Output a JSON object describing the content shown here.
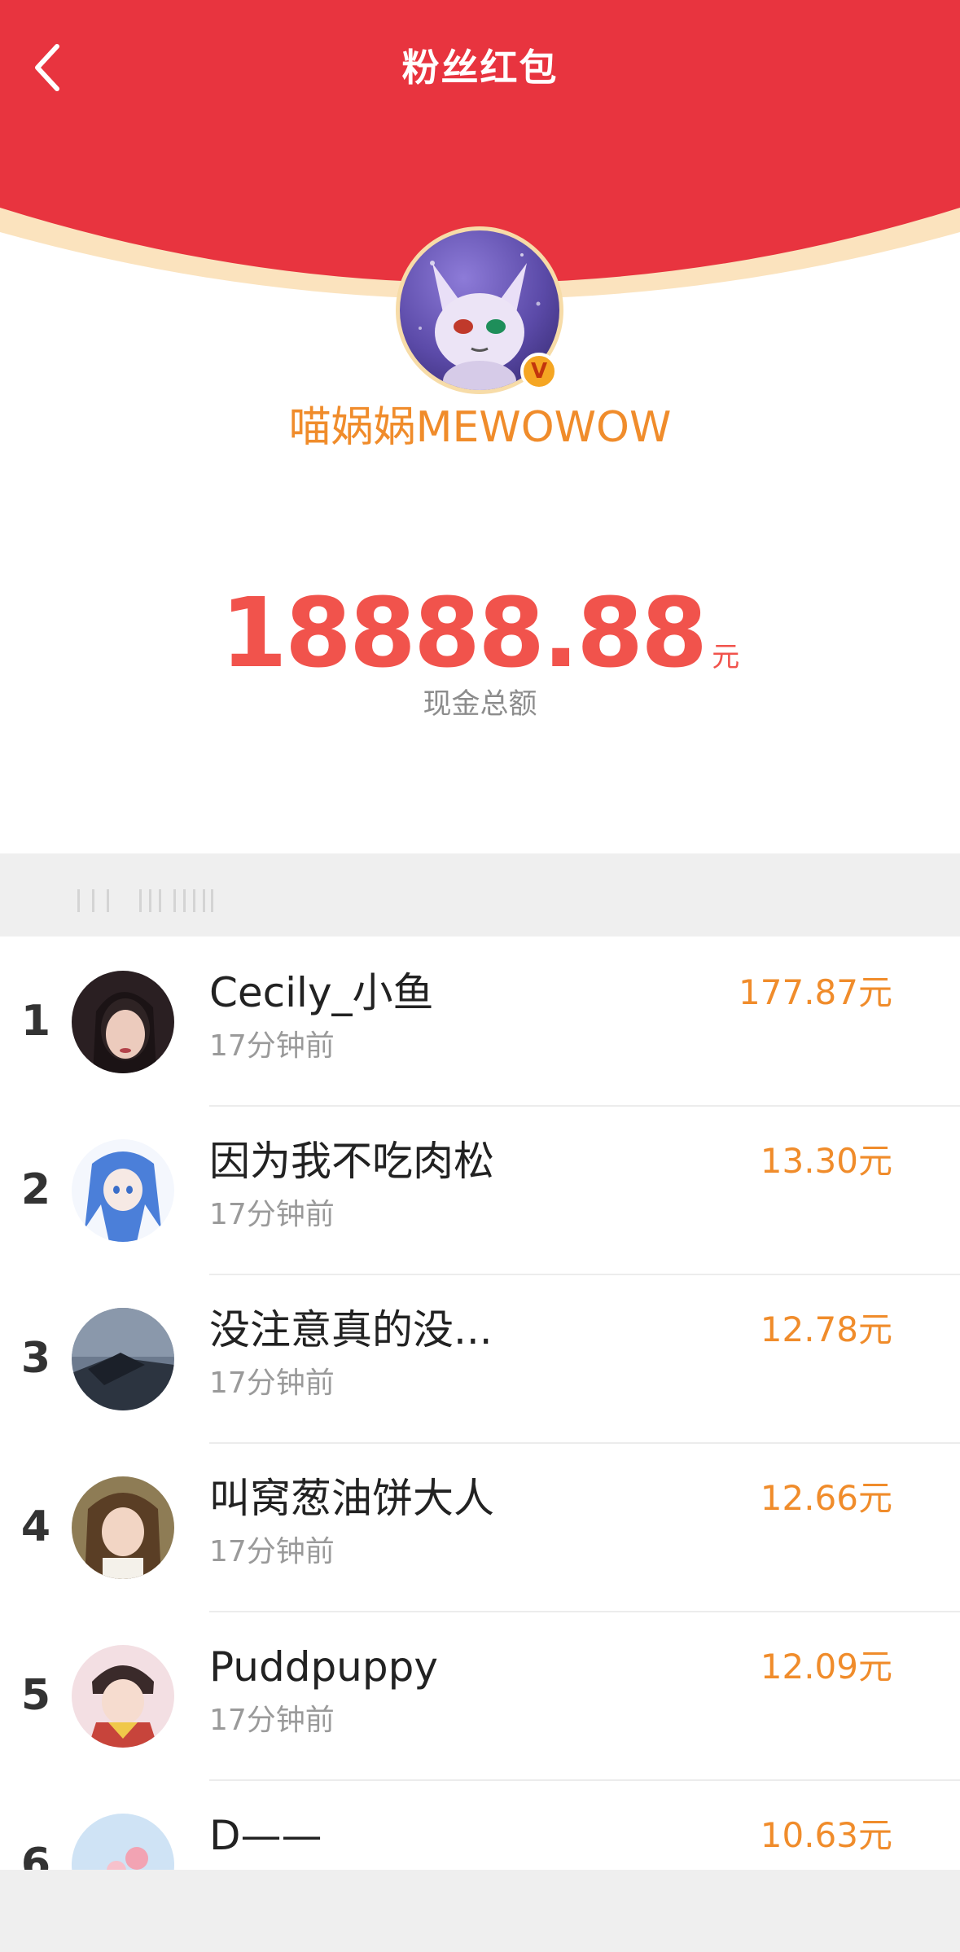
{
  "header": {
    "title": "粉丝红包",
    "background_color": "#e8343f",
    "edge_color": "#fbe3be",
    "back_icon": "chevron-left-icon"
  },
  "profile": {
    "name": "喵娲娲MEWOWOW",
    "verified_badge": "V",
    "name_color": "#f08c2b"
  },
  "summary": {
    "amount": "18888.88",
    "unit": "元",
    "label": "现金总额",
    "amount_color": "#f1534c"
  },
  "list": {
    "rows": [
      {
        "rank": "1",
        "name": "Cecily_小鱼",
        "time": "17分钟前",
        "amount": "177.87元"
      },
      {
        "rank": "2",
        "name": "因为我不吃肉松",
        "time": "17分钟前",
        "amount": "13.30元"
      },
      {
        "rank": "3",
        "name": "没注意真的没...",
        "time": "17分钟前",
        "amount": "12.78元"
      },
      {
        "rank": "4",
        "name": "叫窝葱油饼大人",
        "time": "17分钟前",
        "amount": "12.66元"
      },
      {
        "rank": "5",
        "name": "Puddpuppy",
        "time": "17分钟前",
        "amount": "12.09元"
      },
      {
        "rank": "6",
        "name": "D——",
        "time": "",
        "amount": "10.63元"
      }
    ]
  }
}
